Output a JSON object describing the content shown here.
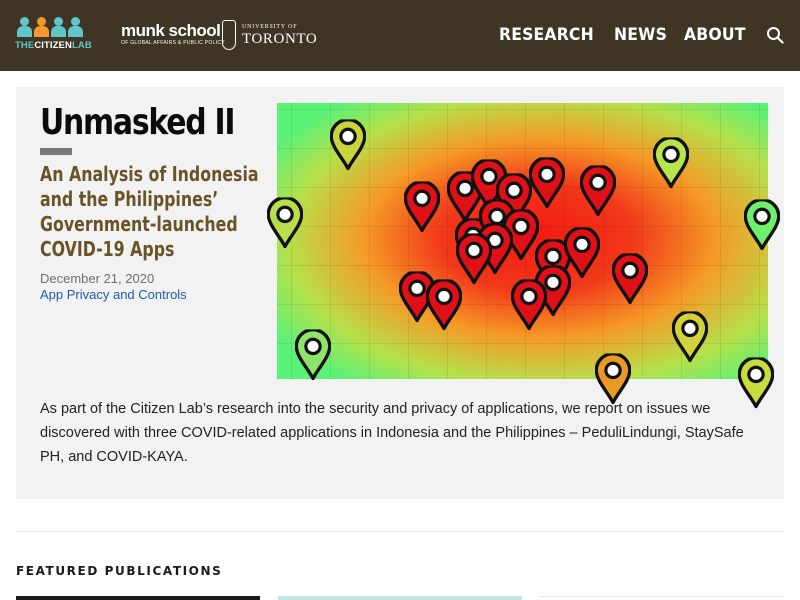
{
  "header": {
    "logo_citizen": {
      "prefix": "THE",
      "main": "CITIZEN",
      "suffix": "LAB"
    },
    "logo_munk": {
      "name": "munk school",
      "tagline": "OF GLOBAL AFFAIRS & PUBLIC POLICY"
    },
    "logo_uoft": {
      "top": "UNIVERSITY OF",
      "bottom": "TORONTO"
    },
    "nav": [
      "RESEARCH",
      "NEWS",
      "ABOUT"
    ],
    "search_icon": "search-icon"
  },
  "feature": {
    "title": "Unmasked II",
    "subtitle": "An Analysis of Indonesia and the Philippines’ Government-launched COVID-19 Apps",
    "date": "December 21, 2020",
    "category": "App Privacy and Controls",
    "image": "heatmap-with-map-pins",
    "excerpt": "As part of the Citizen Lab’s research into the security and privacy of applications, we report on issues we discovered with three COVID-related applications in Indonesia and the Philippines – PeduliLindungi, StaySafe PH, and COVID-KAYA."
  },
  "featured": {
    "heading": "FEATURED PUBLICATIONS"
  },
  "colors": {
    "header_bg": "#3e3525",
    "card_bg": "#f2f2f2",
    "subtitle": "#6b5328",
    "link": "#1f5da8",
    "citizen_teal": "#5fc6c9",
    "citizen_orange": "#f39a2b",
    "pin_red": "#e01018"
  }
}
